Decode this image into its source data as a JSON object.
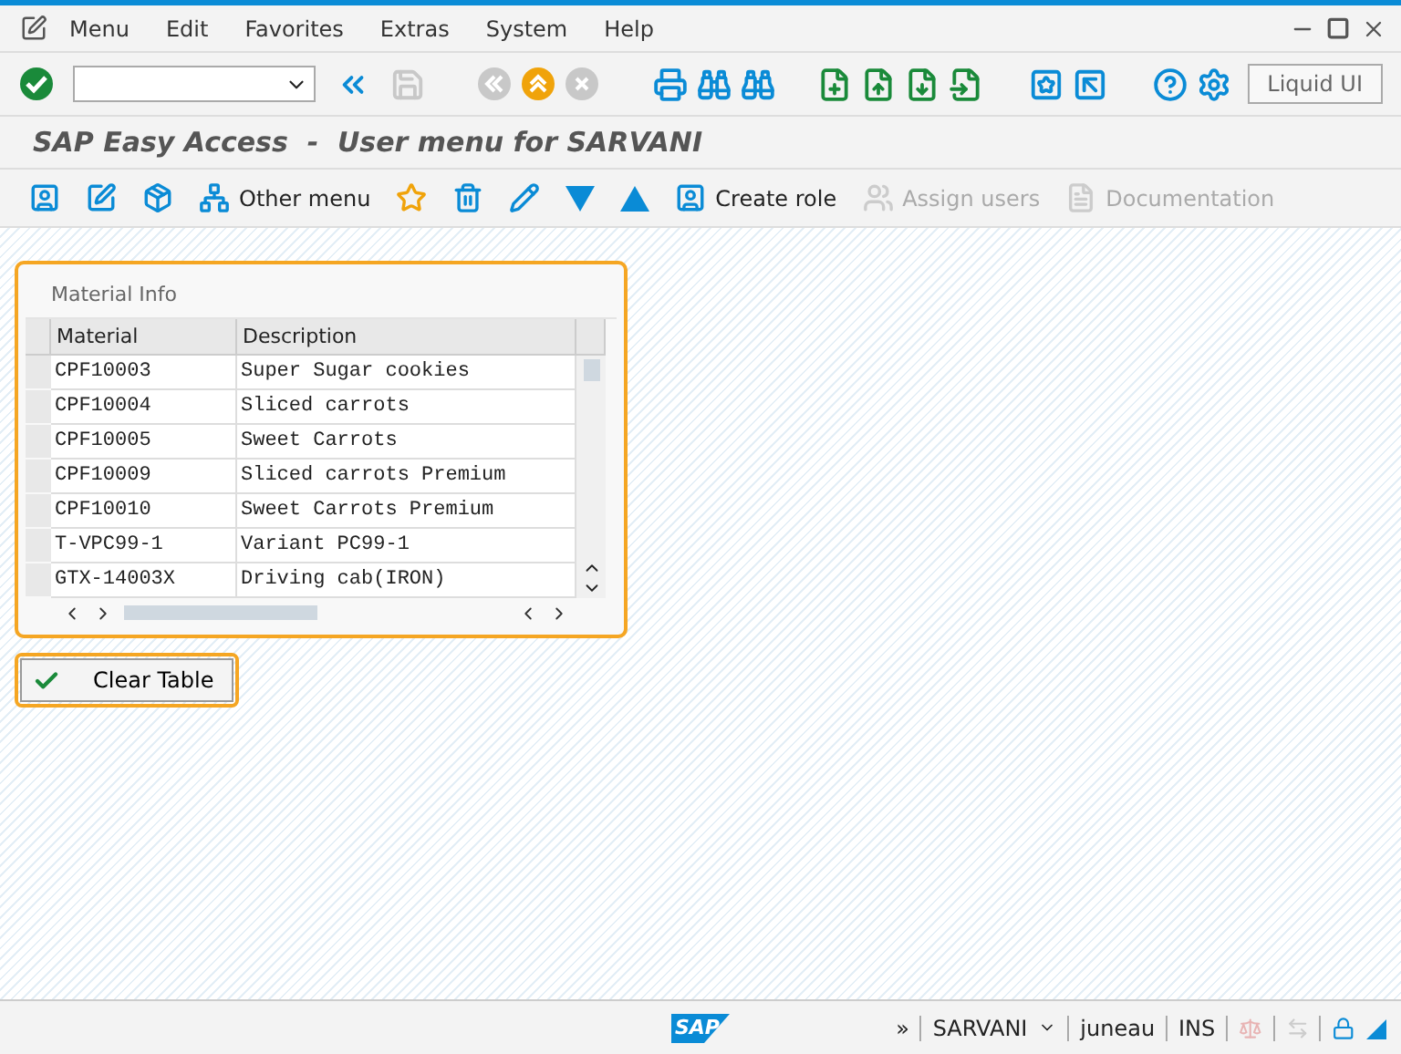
{
  "menu_bar": [
    "Menu",
    "Edit",
    "Favorites",
    "Extras",
    "System",
    "Help"
  ],
  "system_toolbar": {
    "buttons": [
      {
        "disabled": false
      },
      {
        "disabled": false
      },
      {
        "disabled": true
      },
      {
        "disabled": true
      },
      {
        "disabled": false
      },
      {
        "disabled": true
      },
      {
        "disabled": false
      },
      {
        "disabled": false
      },
      {
        "disabled": false
      },
      {
        "disabled": false
      },
      {
        "disabled": false
      },
      {
        "disabled": false
      },
      {
        "disabled": false
      },
      {
        "disabled": false
      },
      {
        "disabled": false
      },
      {
        "disabled": false
      },
      {
        "disabled": false
      }
    ],
    "liquid_ui": "Liquid UI"
  },
  "screen_title": "SAP Easy Access  -  User menu for SARVANI",
  "app_toolbar": [
    {
      "disabled": false
    },
    {
      "disabled": false
    },
    {
      "disabled": false
    },
    {
      "label": "Other menu",
      "disabled": false
    },
    {
      "disabled": false
    },
    {
      "disabled": false
    },
    {
      "disabled": false
    },
    {
      "disabled": false
    },
    {
      "disabled": false
    },
    {
      "label": "Create role",
      "disabled": false
    },
    {
      "label": "Assign users",
      "disabled": true
    },
    {
      "label": "Documentation",
      "disabled": true
    }
  ],
  "group": {
    "title": "Material Info",
    "columns": [
      "Material",
      "Description"
    ],
    "rows": [
      [
        "CPF10003",
        "Super Sugar cookies"
      ],
      [
        "CPF10004",
        "Sliced carrots"
      ],
      [
        "CPF10005",
        "Sweet Carrots"
      ],
      [
        "CPF10009",
        "Sliced carrots Premium"
      ],
      [
        "CPF10010",
        "Sweet Carrots Premium"
      ],
      [
        "T-VPC99-1",
        "Variant PC99-1"
      ],
      [
        "GTX-14003X",
        "Driving cab(IRON)"
      ]
    ]
  },
  "clear_button": "Clear Table",
  "status_bar": {
    "logo": "SAP",
    "more": "»",
    "user": "SARVANI",
    "server": "juneau",
    "mode": "INS"
  }
}
